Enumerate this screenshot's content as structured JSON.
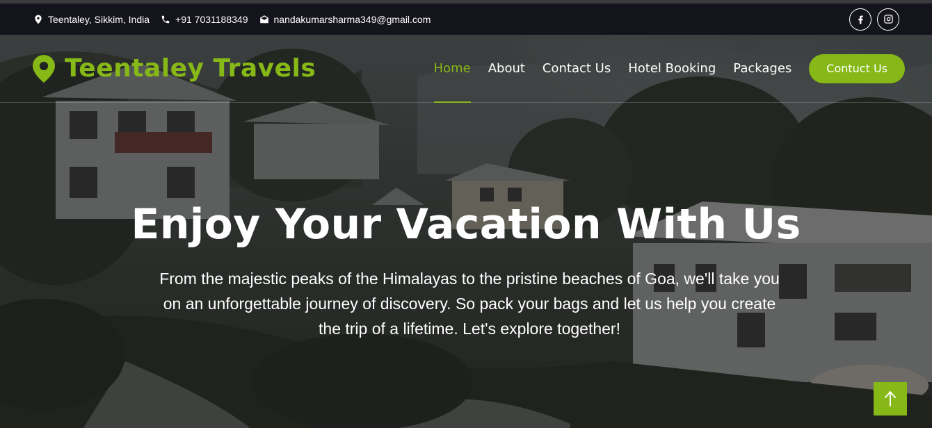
{
  "topbar": {
    "location": "Teentaley, Sikkim, India",
    "phone": "+91 7031188349",
    "email": "nandakumarsharma349@gmail.com",
    "social": [
      {
        "icon": "facebook-icon"
      },
      {
        "icon": "instagram-icon"
      }
    ]
  },
  "navbar": {
    "brand": "Teentaley Travels",
    "brand_icon": "map-marker-icon",
    "links": [
      {
        "label": "Home",
        "active": true
      },
      {
        "label": "About"
      },
      {
        "label": "Contact Us"
      },
      {
        "label": "Hotel Booking"
      },
      {
        "label": "Packages"
      }
    ],
    "cta_label": "Contuct Us"
  },
  "hero": {
    "title": "Enjoy Your Vacation With Us",
    "subtitle": "From the majestic peaks of the Himalayas to the pristine beaches of Goa, we'll take you on an unforgettable journey of discovery. So pack your bags and let us help you create the trip of a lifetime. Let's explore together!"
  },
  "back_to_top": {
    "icon": "arrow-up-icon"
  },
  "colors": {
    "accent": "#86b817",
    "topbar_bg": "#14141d",
    "text": "#ffffff"
  }
}
